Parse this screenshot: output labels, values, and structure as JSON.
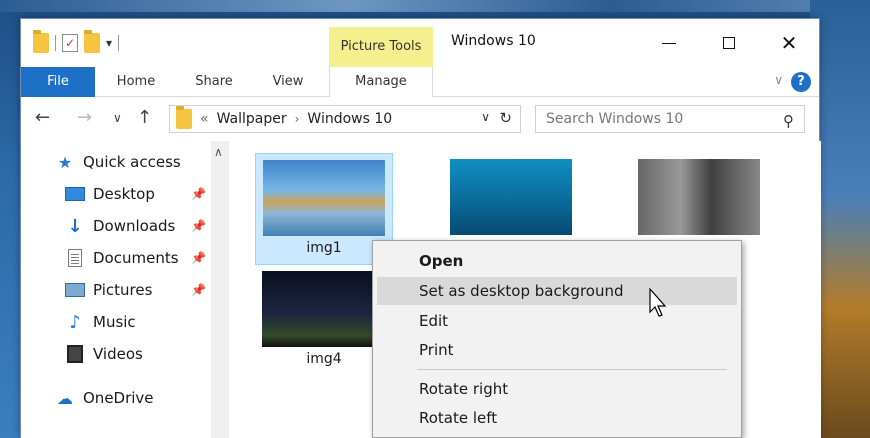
{
  "window": {
    "title": "Windows 10",
    "picture_tools_label": "Picture Tools"
  },
  "ribbon": {
    "tabs": [
      "File",
      "Home",
      "Share",
      "View",
      "Manage"
    ]
  },
  "address_bar": {
    "overflow": "«",
    "parts": [
      "Wallpaper",
      "Windows 10"
    ],
    "separator": "›"
  },
  "search": {
    "placeholder": "Search Windows 10"
  },
  "nav_pane": {
    "quick_access": "Quick access",
    "items": [
      {
        "label": "Desktop",
        "pinned": true
      },
      {
        "label": "Downloads",
        "pinned": true
      },
      {
        "label": "Documents",
        "pinned": true
      },
      {
        "label": "Pictures",
        "pinned": true
      },
      {
        "label": "Music",
        "pinned": false
      },
      {
        "label": "Videos",
        "pinned": false
      }
    ],
    "onedrive": "OneDrive"
  },
  "files": [
    {
      "name": "img1",
      "selected": true
    },
    {
      "name": "",
      "selected": false
    },
    {
      "name": "",
      "selected": false
    },
    {
      "name": "img4",
      "selected": false
    }
  ],
  "context_menu": {
    "items": [
      "Open",
      "Set as desktop background",
      "Edit",
      "Print",
      "Rotate right",
      "Rotate left"
    ],
    "hovered": "Set as desktop background",
    "default": "Open"
  },
  "colors": {
    "accent": "#1e6fc6",
    "picture_tools_bg": "#f6ef8e",
    "selection_bg": "#cce8ff",
    "menu_bg": "#f2f2f2",
    "menu_hover": "#d9d9d9"
  }
}
